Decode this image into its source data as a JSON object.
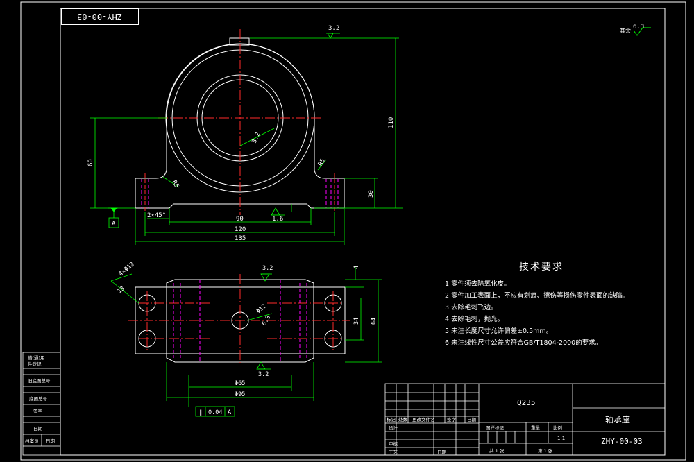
{
  "drawing_code_mirrored": "ZHY-00-03",
  "part_code": "ZHY-00-03",
  "part_name": "轴承座",
  "material": "Q235",
  "scale": "1:1",
  "surface_finish_other": "其余",
  "roughness_values": {
    "top_face": "3.2",
    "bore": "3.2",
    "other": "6.3",
    "base_hole": "3.2",
    "base_top": "1.6",
    "slot": "3.2",
    "center_hole": "6.3"
  },
  "dimensions_front": {
    "height_overall": "110",
    "center_height": "60",
    "base_height": "30",
    "inner_width": "90",
    "hole_spacing": "120",
    "overall_length": "135",
    "fillet": "R5",
    "fillet_right": "R5",
    "chamfer": "2×45°",
    "datum": "A"
  },
  "dimensions_top": {
    "slot_holes": "4×Φ12",
    "slot_depth": "13",
    "center_hole": "Φ12",
    "width_inner": "34",
    "width_overall": "64",
    "length_inner": "Φ65",
    "length_overall": "Φ95",
    "top_offset": "4"
  },
  "geometric_tolerance": {
    "symbol": "∥",
    "value": "0.04",
    "datum": "A"
  },
  "technical_requirements": {
    "title": "技术要求",
    "items": [
      "1.零件须去除氧化皮。",
      "2.零件加工表面上，不应有划痕、擦伤等损伤零件表面的缺陷。",
      "3.去除毛刺飞边。",
      "4.去除毛刺，抛光。",
      "5.未注长度尺寸允许偏差±0.5mm。",
      "6.未注线性尺寸公差应符合GB/T1804-2000的要求。"
    ]
  },
  "side_table_labels": [
    "借(通)用",
    "件登记",
    "旧底图总号",
    "底图总号",
    "签字",
    "日期",
    "档案员",
    "日期"
  ],
  "title_block_labels": {
    "row1": [
      "标记",
      "处数",
      "更改文件名",
      "签字",
      "日期"
    ],
    "design": "设计",
    "check": "审核",
    "process": "工艺",
    "date": "日期",
    "stage": "图样标记",
    "weight": "重量",
    "scale_label": "比例",
    "sheet": "共 1 张",
    "sheet_no": "第 1 张"
  },
  "colors": {
    "outline": "#ffffff",
    "dimension": "#00ff00",
    "centerline": "#ff2a2a",
    "hidden": "#ff00ff",
    "background": "#000000"
  }
}
